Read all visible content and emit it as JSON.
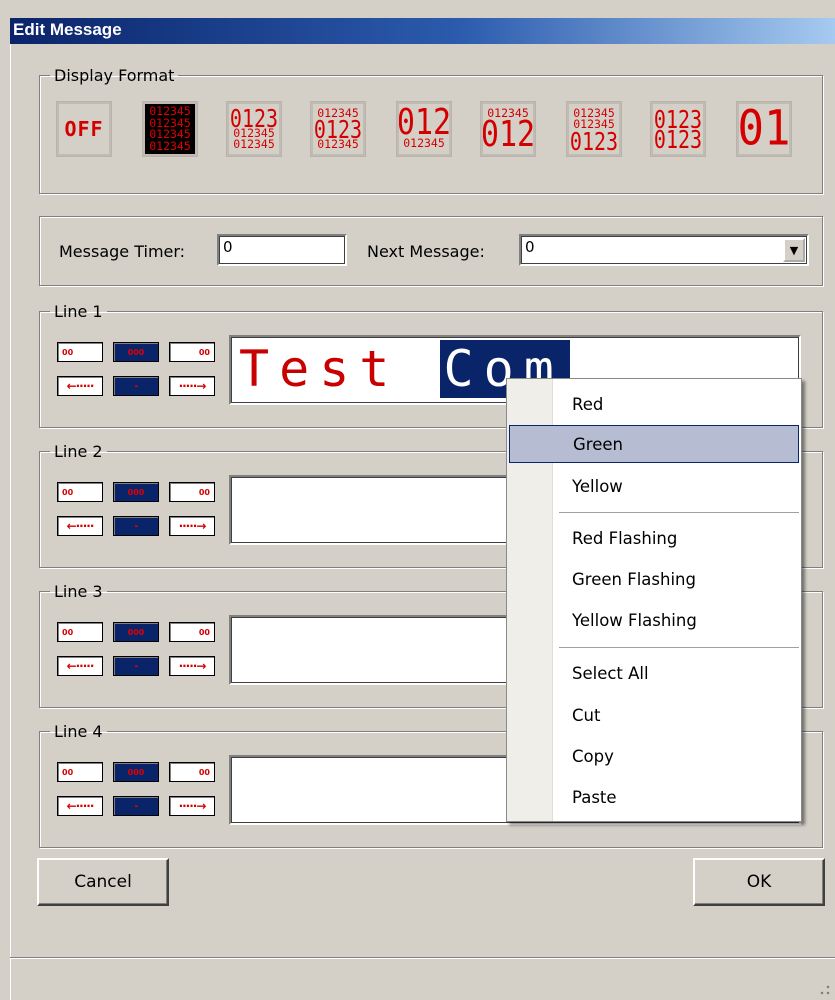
{
  "window": {
    "title": "Edit Message"
  },
  "display_format": {
    "legend": "Display Format",
    "off_label": "OFF",
    "options": [
      {
        "lines": [
          "012345",
          "012345",
          "012345",
          "012345"
        ]
      },
      {
        "lines": [
          "0123",
          "012345",
          "012345"
        ]
      },
      {
        "lines": [
          "012345",
          "0123",
          "012345"
        ]
      },
      {
        "lines": [
          "012",
          "012345"
        ]
      },
      {
        "lines": [
          "012345",
          "012"
        ]
      },
      {
        "lines": [
          "012345",
          "012345",
          "0123"
        ]
      },
      {
        "lines": [
          "0123",
          "0123"
        ]
      },
      {
        "lines": [
          "01"
        ]
      }
    ]
  },
  "timer": {
    "message_timer_label": "Message Timer:",
    "message_timer_value": "0",
    "next_message_label": "Next Message:",
    "next_message_value": "0"
  },
  "lines": [
    {
      "legend": "Line 1",
      "text": "Test ",
      "selected_text": "Com"
    },
    {
      "legend": "Line 2",
      "text": "",
      "selected_text": ""
    },
    {
      "legend": "Line 3",
      "text": "",
      "selected_text": ""
    },
    {
      "legend": "Line 4",
      "text": "",
      "selected_text": ""
    }
  ],
  "line_controls": {
    "size_small": "00",
    "size_medium": "000",
    "size_right": "00",
    "scroll_left": "←·····",
    "center": "-",
    "scroll_right": "·····→"
  },
  "buttons": {
    "cancel": "Cancel",
    "ok": "OK"
  },
  "context_menu": {
    "items": [
      {
        "label": "Red"
      },
      {
        "label": "Green",
        "hover": true
      },
      {
        "label": "Yellow"
      },
      {
        "label": "Red Flashing"
      },
      {
        "label": "Green Flashing"
      },
      {
        "label": "Yellow Flashing"
      },
      {
        "label": "Select All"
      },
      {
        "label": "Cut"
      },
      {
        "label": "Copy"
      },
      {
        "label": "Paste"
      }
    ]
  },
  "colors": {
    "title_bar": "#0a246a",
    "led_red": "#c80000",
    "selection": "#0a246a",
    "menu_hover": "#b6bdd2"
  }
}
